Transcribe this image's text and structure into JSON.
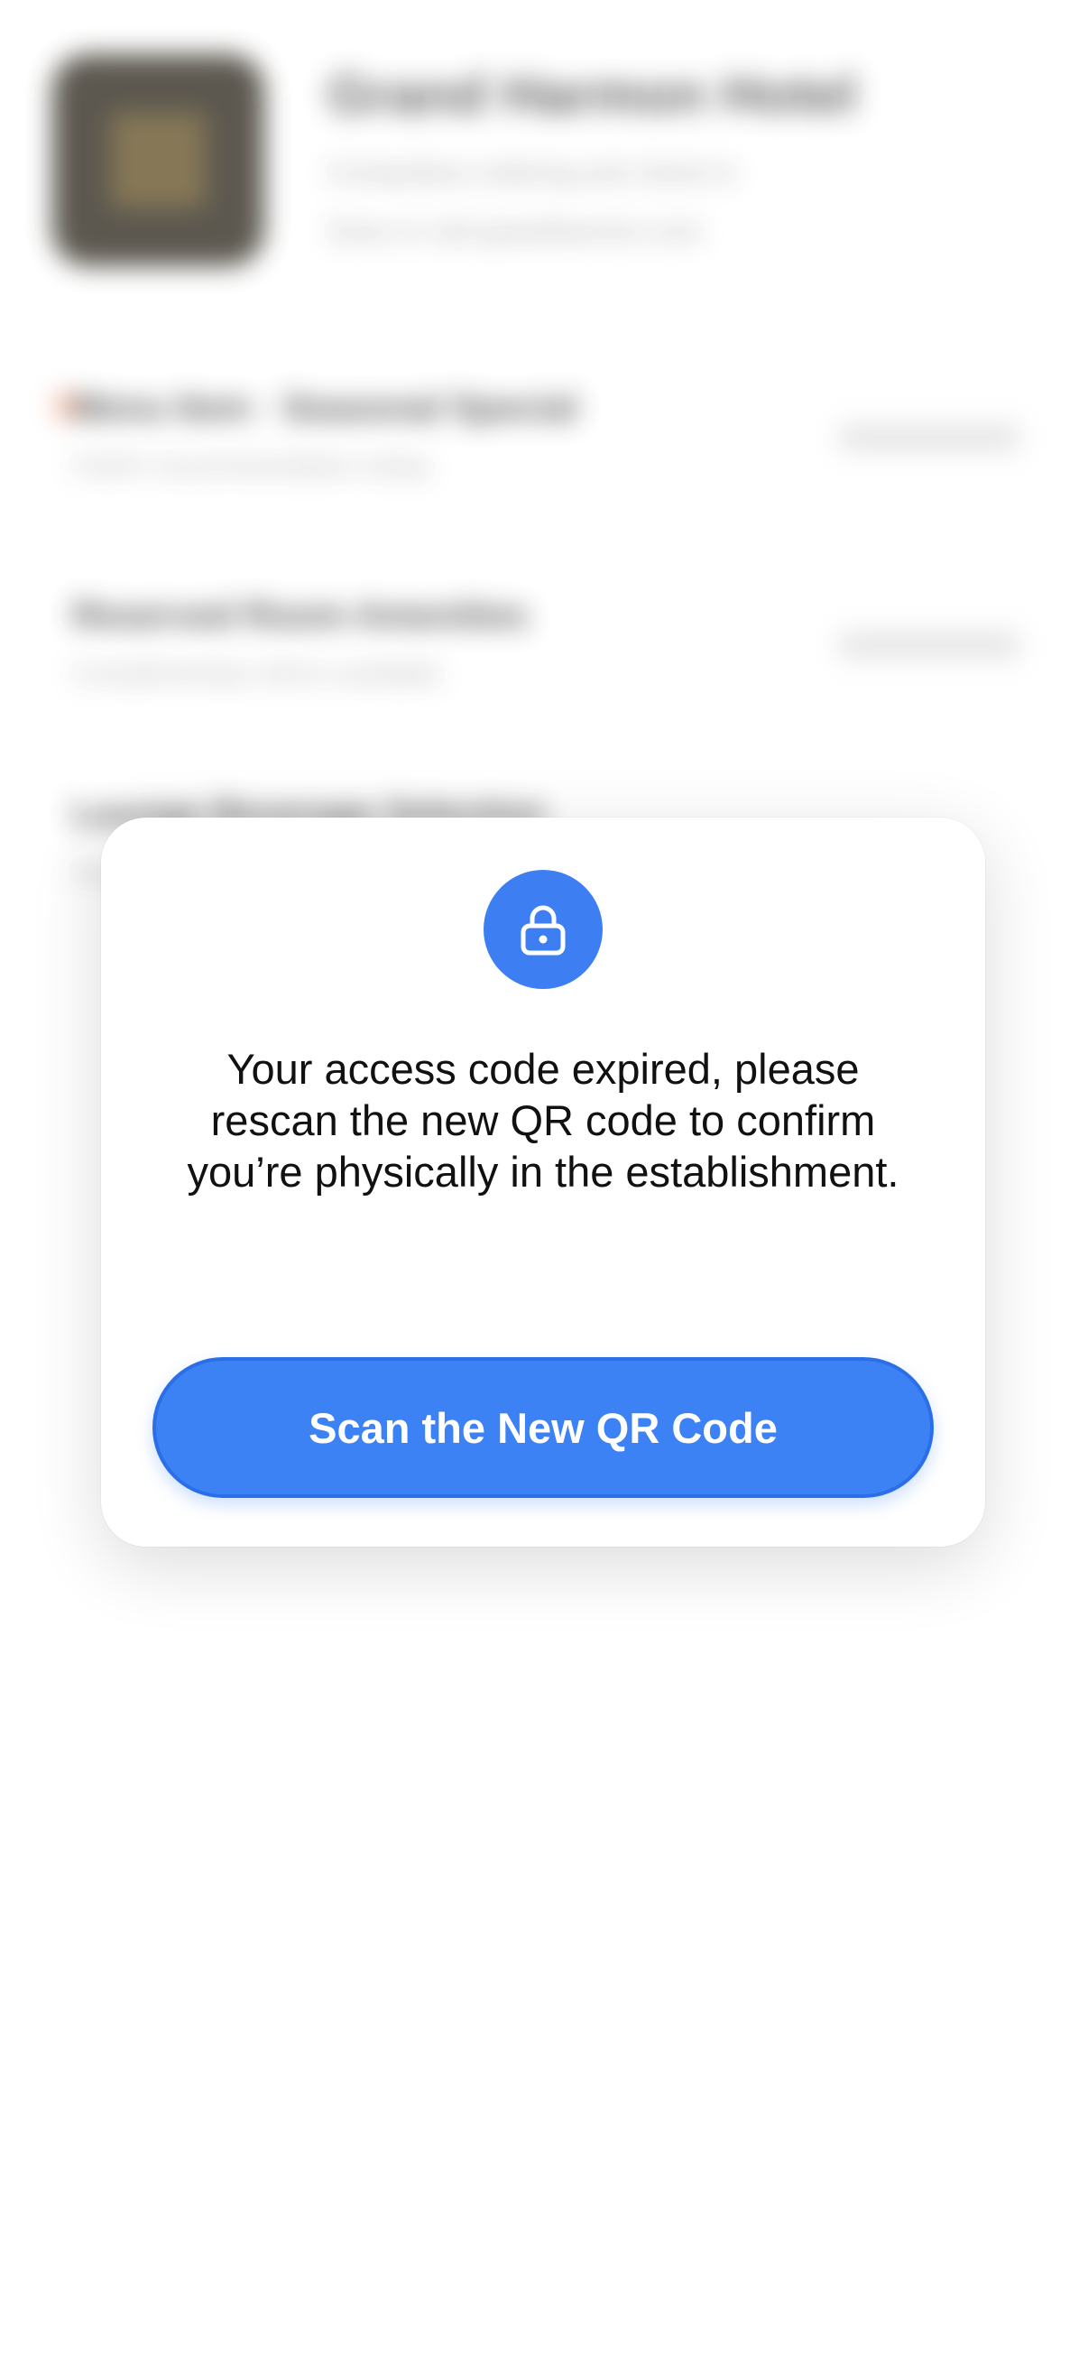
{
  "background": {
    "venue_name": "Grand Harmon Hotel",
    "venue_line1": "Contactless ordering and check-in",
    "venue_line2": "Scan or visit grandharmon.com",
    "rows": [
      {
        "title": "Menu Item · Seasonal Special",
        "subtitle": "Chef's recommendation today"
      },
      {
        "title": "Reserved Room Amenities",
        "subtitle": "Complimentary items available"
      },
      {
        "title": "Lounge Beverage Selection",
        "subtitle": "Available until midnight"
      }
    ]
  },
  "modal": {
    "icon": "lock-icon",
    "message": "Your access code expired, please rescan the new QR code to confirm you’re physically in the establishment.",
    "button_label": "Scan the New QR Code"
  },
  "colors": {
    "accent": "#3d82f4",
    "accent_border": "#2a6fe8",
    "text": "#111111",
    "card": "#ffffff"
  }
}
